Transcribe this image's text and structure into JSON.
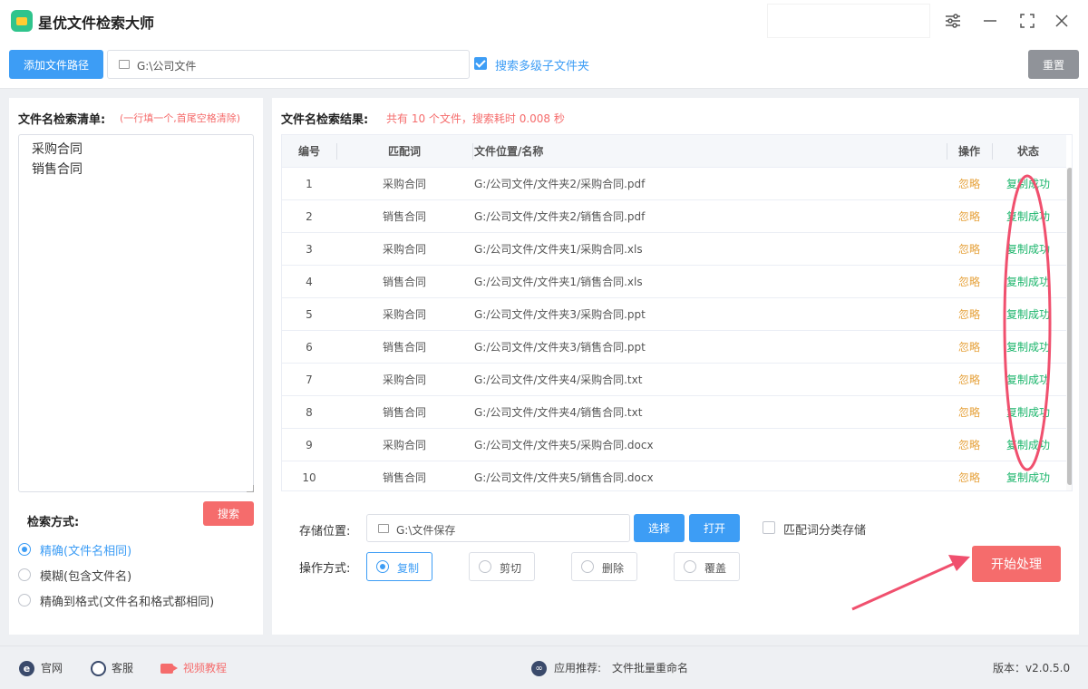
{
  "app": {
    "title": "星优文件检索大师"
  },
  "toolbar": {
    "add_path_label": "添加文件路径",
    "path_value": "G:\\公司文件",
    "subfolder_label": "搜索多级子文件夹",
    "subfolder_checked": true,
    "reset_label": "重置"
  },
  "left": {
    "list_title": "文件名检索清单:",
    "list_hint": "(一行填一个,首尾空格清除)",
    "keywords": "采购合同\n销售合同",
    "search_mode_title": "检索方式:",
    "search_button": "搜索",
    "modes": [
      {
        "label": "精确(文件名相同)",
        "selected": true
      },
      {
        "label": "模糊(包含文件名)",
        "selected": false
      },
      {
        "label": "精确到格式(文件名和格式都相同)",
        "selected": false
      }
    ]
  },
  "results": {
    "title": "文件名检索结果:",
    "summary": "共有 10 个文件，搜索耗时 0.008 秒",
    "columns": {
      "index": "编号",
      "keyword": "匹配词",
      "path": "文件位置/名称",
      "op": "操作",
      "status": "状态"
    },
    "rows": [
      {
        "index": "1",
        "keyword": "采购合同",
        "path": "G:/公司文件/文件夹2/采购合同.pdf",
        "op": "忽略",
        "status": "复制成功"
      },
      {
        "index": "2",
        "keyword": "销售合同",
        "path": "G:/公司文件/文件夹2/销售合同.pdf",
        "op": "忽略",
        "status": "复制成功"
      },
      {
        "index": "3",
        "keyword": "采购合同",
        "path": "G:/公司文件/文件夹1/采购合同.xls",
        "op": "忽略",
        "status": "复制成功"
      },
      {
        "index": "4",
        "keyword": "销售合同",
        "path": "G:/公司文件/文件夹1/销售合同.xls",
        "op": "忽略",
        "status": "复制成功"
      },
      {
        "index": "5",
        "keyword": "采购合同",
        "path": "G:/公司文件/文件夹3/采购合同.ppt",
        "op": "忽略",
        "status": "复制成功"
      },
      {
        "index": "6",
        "keyword": "销售合同",
        "path": "G:/公司文件/文件夹3/销售合同.ppt",
        "op": "忽略",
        "status": "复制成功"
      },
      {
        "index": "7",
        "keyword": "采购合同",
        "path": "G:/公司文件/文件夹4/采购合同.txt",
        "op": "忽略",
        "status": "复制成功"
      },
      {
        "index": "8",
        "keyword": "销售合同",
        "path": "G:/公司文件/文件夹4/销售合同.txt",
        "op": "忽略",
        "status": "复制成功"
      },
      {
        "index": "9",
        "keyword": "采购合同",
        "path": "G:/公司文件/文件夹5/采购合同.docx",
        "op": "忽略",
        "status": "复制成功"
      },
      {
        "index": "10",
        "keyword": "销售合同",
        "path": "G:/公司文件/文件夹5/销售合同.docx",
        "op": "忽略",
        "status": "复制成功"
      }
    ]
  },
  "output": {
    "save_label": "存储位置:",
    "save_path": "G:\\文件保存",
    "choose_label": "选择",
    "open_label": "打开",
    "classify_label": "匹配词分类存储",
    "classify_checked": false,
    "op_label": "操作方式:",
    "ops": [
      {
        "label": "复制",
        "selected": true
      },
      {
        "label": "剪切",
        "selected": false
      },
      {
        "label": "删除",
        "selected": false
      },
      {
        "label": "覆盖",
        "selected": false
      }
    ],
    "start_label": "开始处理"
  },
  "statusbar": {
    "website": "官网",
    "service": "客服",
    "video": "视频教程",
    "recommend_prefix": "应用推荐:",
    "recommend_app": "文件批量重命名",
    "version": "版本：v2.0.5.0"
  },
  "colors": {
    "accent": "#3d9df5",
    "danger": "#f56c6c",
    "success": "#1bb56b",
    "warning": "#e6a23c"
  }
}
